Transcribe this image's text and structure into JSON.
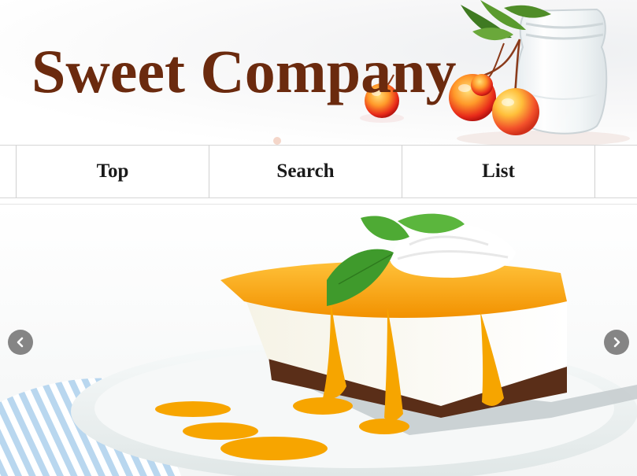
{
  "header": {
    "title": "Sweet Company",
    "title_color": "#6b2a0e",
    "image": "cherries-in-glass-jar"
  },
  "nav": {
    "items": [
      {
        "label": "Top"
      },
      {
        "label": "Search"
      },
      {
        "label": "List"
      }
    ]
  },
  "slider": {
    "image": "mango-cheesecake-slice",
    "prev_icon": "chevron-left-icon",
    "next_icon": "chevron-right-icon"
  }
}
